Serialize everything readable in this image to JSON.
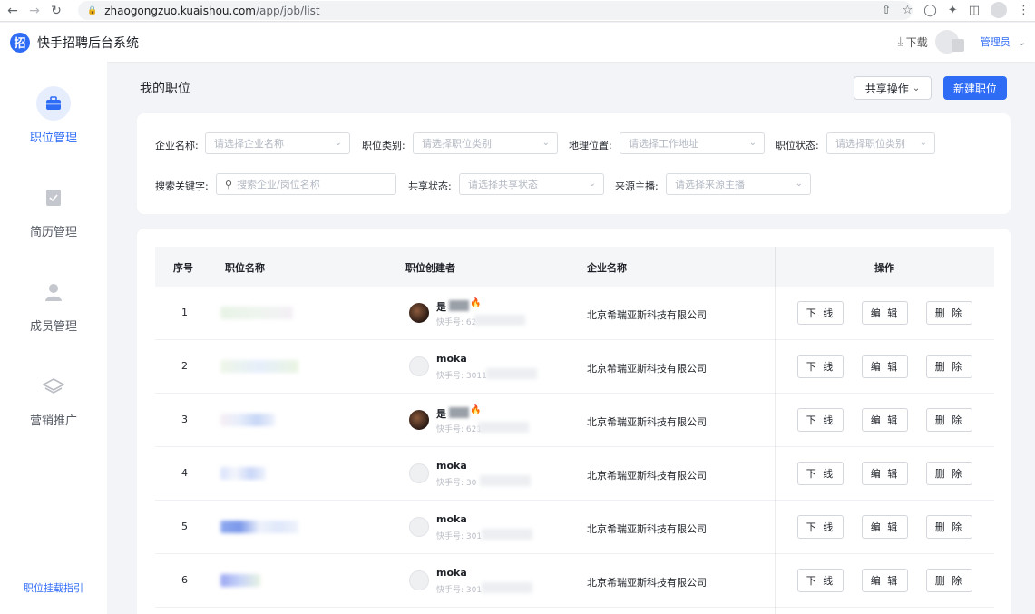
{
  "browser": {
    "url_host": "zhaogongzuo.kuaishou.com",
    "url_path": "/app/job/list"
  },
  "app": {
    "logo_char": "招",
    "title": "快手招聘后台系统",
    "download_label": "下载",
    "role_label": "管理员"
  },
  "sidebar": {
    "items": [
      {
        "label": "职位管理",
        "icon": "briefcase-icon",
        "active": true
      },
      {
        "label": "简历管理",
        "icon": "resume-icon",
        "active": false
      },
      {
        "label": "成员管理",
        "icon": "person-icon",
        "active": false
      },
      {
        "label": "营销推广",
        "icon": "layers-icon",
        "active": false
      }
    ],
    "guide_label": "职位挂载指引"
  },
  "page": {
    "title": "我的职位",
    "share_button": "共享操作",
    "new_button": "新建职位"
  },
  "filters": {
    "company_label": "企业名称:",
    "company_placeholder": "请选择企业名称",
    "category_label": "职位类别:",
    "category_placeholder": "请选择职位类别",
    "location_label": "地理位置:",
    "location_placeholder": "请选择工作地址",
    "status_label": "职位状态:",
    "status_placeholder": "请选择职位类别",
    "keyword_label": "搜索关键字:",
    "keyword_placeholder": "搜索企业/岗位名称",
    "share_label": "共享状态:",
    "share_placeholder": "请选择共享状态",
    "source_label": "来源主播:",
    "source_placeholder": "请选择来源主播"
  },
  "table": {
    "headers": {
      "index": "序号",
      "job_name": "职位名称",
      "creator": "职位创建者",
      "company": "企业名称",
      "actions": "操作"
    },
    "action_labels": {
      "offline": "下 线",
      "edit": "编 辑",
      "delete": "删 除"
    },
    "rows": [
      {
        "index": "1",
        "creator_name": "是",
        "creator_id_prefix": "快手号: 62",
        "company": "北京希瑞亚斯科技有限公司",
        "avatar": "dark"
      },
      {
        "index": "2",
        "creator_name": "moka",
        "creator_id_prefix": "快手号: 3011",
        "company": "北京希瑞亚斯科技有限公司",
        "avatar": "light"
      },
      {
        "index": "3",
        "creator_name": "是",
        "creator_id_prefix": "快手号: 621",
        "company": "北京希瑞亚斯科技有限公司",
        "avatar": "dark"
      },
      {
        "index": "4",
        "creator_name": "moka",
        "creator_id_prefix": "快手号: 30",
        "company": "北京希瑞亚斯科技有限公司",
        "avatar": "light"
      },
      {
        "index": "5",
        "creator_name": "moka",
        "creator_id_prefix": "快手号: 301",
        "company": "北京希瑞亚斯科技有限公司",
        "avatar": "light"
      },
      {
        "index": "6",
        "creator_name": "moka",
        "creator_id_prefix": "快手号: 301",
        "company": "北京希瑞亚斯科技有限公司",
        "avatar": "light"
      }
    ]
  }
}
